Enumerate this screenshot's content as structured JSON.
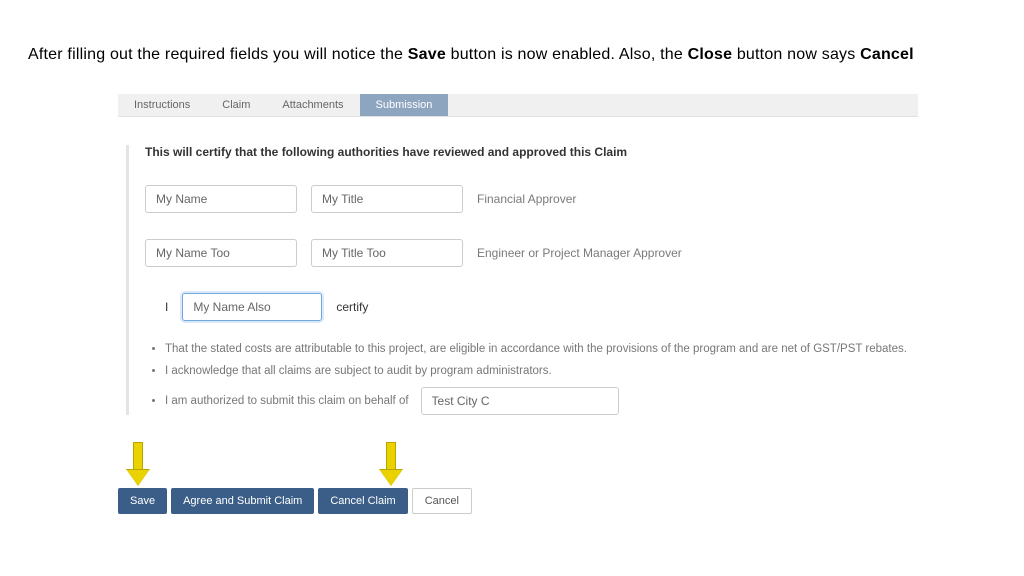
{
  "caption": {
    "pre": "After filling out the required fields you will notice the ",
    "b1": "Save",
    "mid1": " button is now enabled. Also, the ",
    "b2": "Close",
    "mid2": " button now says ",
    "b3": "Cancel"
  },
  "tabs": {
    "instructions": "Instructions",
    "claim": "Claim",
    "attachments": "Attachments",
    "submission": "Submission"
  },
  "form": {
    "title": "This will certify that the following authorities have reviewed and approved this Claim",
    "financial": {
      "name": "My Name",
      "title": "My Title",
      "role": "Financial Approver"
    },
    "engineer": {
      "name": "My Name Too",
      "title": "My Title Too",
      "role": "Engineer or Project Manager Approver"
    },
    "certify_row": {
      "prefix": "I",
      "name": "My Name Also",
      "suffix": "certify"
    },
    "bullets": {
      "b1": "That the stated costs are attributable to this project, are eligible in accordance with the provisions of the program and are net of GST/PST rebates.",
      "b2": "I acknowledge that all claims are subject to audit by program administrators.",
      "b3_text": "I am authorized to submit this claim on behalf of",
      "b3_value": "Test City C"
    }
  },
  "buttons": {
    "save": "Save",
    "agree_submit": "Agree and Submit Claim",
    "cancel_claim": "Cancel Claim",
    "cancel": "Cancel"
  }
}
